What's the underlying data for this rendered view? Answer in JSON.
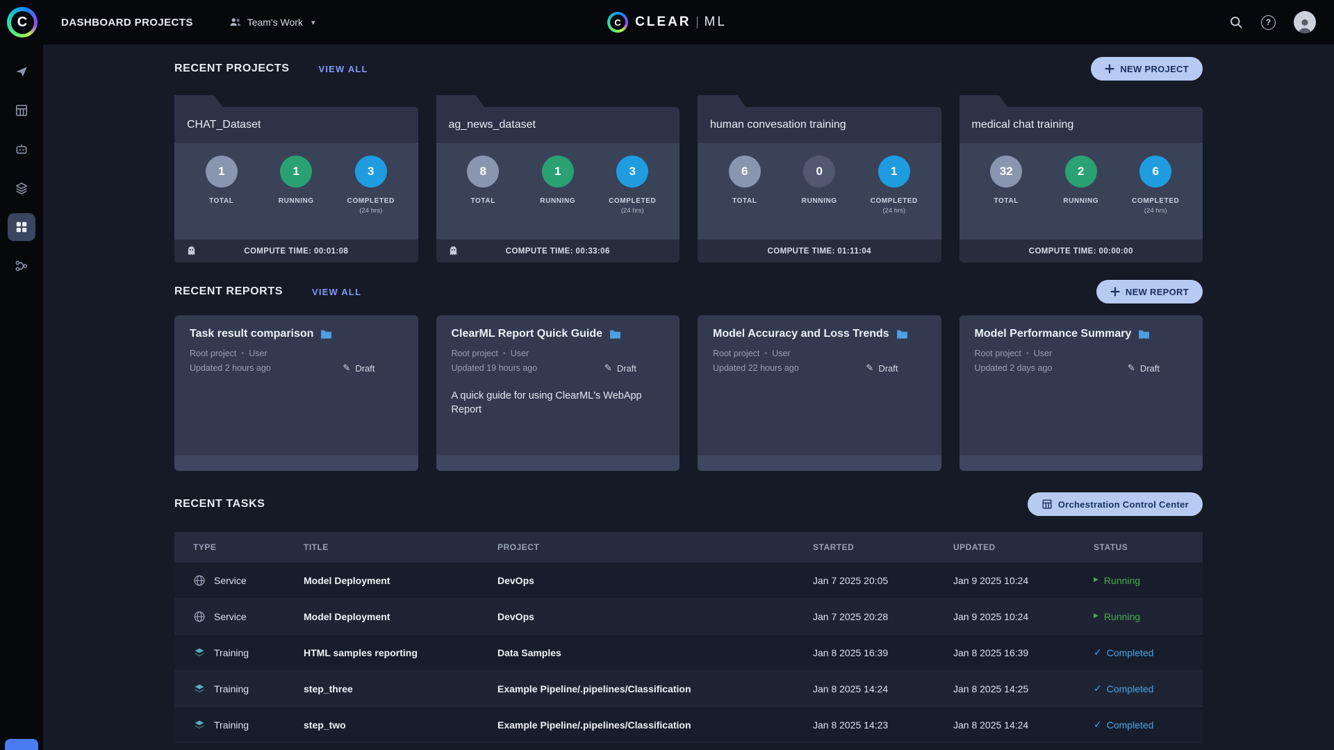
{
  "topbar": {
    "title": "DASHBOARD PROJECTS",
    "workspace": "Team's Work",
    "logo": {
      "clear": "CLEAR",
      "ml": "ML"
    }
  },
  "icons": {
    "logo_letter": "C",
    "caret": "▾",
    "question": "?",
    "dot": "•",
    "pencil": "✎",
    "play": "▶",
    "check": "✓"
  },
  "colors": {
    "accent_link": "#7f9cf7",
    "pill_bg": "#b7cbf2",
    "pill_text": "#17305e",
    "running_green": "#2aa173",
    "completed_blue": "#1f9ce0",
    "status_running": "#47ad4d",
    "status_completed": "#4aa4e8",
    "card_bg": "#3a4258",
    "page_bg": "#151a27"
  },
  "projects_section": {
    "heading": "RECENT PROJECTS",
    "view_all": "VIEW ALL",
    "new_button": "NEW PROJECT",
    "labels": {
      "total": "TOTAL",
      "running": "RUNNING",
      "completed": "COMPLETED",
      "period": "(24 hrs)"
    },
    "cards": [
      {
        "name": "CHAT_Dataset",
        "total": "1",
        "running": "1",
        "completed": "3",
        "compute_time": "COMPUTE TIME: 00:01:08",
        "ghost": true
      },
      {
        "name": "ag_news_dataset",
        "total": "8",
        "running": "1",
        "completed": "3",
        "compute_time": "COMPUTE TIME: 00:33:06",
        "ghost": true
      },
      {
        "name": "human convesation training",
        "total": "6",
        "running": "0",
        "completed": "1",
        "compute_time": "COMPUTE TIME: 01:11:04",
        "ghost": false
      },
      {
        "name": "medical chat training",
        "total": "32",
        "running": "2",
        "completed": "6",
        "compute_time": "COMPUTE TIME: 00:00:00",
        "ghost": false
      }
    ]
  },
  "reports_section": {
    "heading": "RECENT REPORTS",
    "view_all": "VIEW ALL",
    "new_button": "NEW REPORT",
    "cards": [
      {
        "title": "Task result comparison",
        "meta_project": "Root project",
        "meta_user": "User",
        "updated": "Updated 2 hours ago",
        "status": "Draft",
        "description": ""
      },
      {
        "title": "ClearML Report Quick Guide",
        "meta_project": "Root project",
        "meta_user": "User",
        "updated": "Updated 19 hours ago",
        "status": "Draft",
        "description": "A quick guide for using ClearML's WebApp Report"
      },
      {
        "title": "Model Accuracy and Loss Trends",
        "meta_project": "Root project",
        "meta_user": "User",
        "updated": "Updated 22 hours ago",
        "status": "Draft",
        "description": ""
      },
      {
        "title": "Model Performance Summary",
        "meta_project": "Root project",
        "meta_user": "User",
        "updated": "Updated 2 days ago",
        "status": "Draft",
        "description": ""
      }
    ]
  },
  "tasks_section": {
    "heading": "RECENT TASKS",
    "orchestration_button": "Orchestration Control Center",
    "columns": [
      "TYPE",
      "TITLE",
      "PROJECT",
      "STARTED",
      "UPDATED",
      "STATUS"
    ],
    "rows": [
      {
        "type": "Service",
        "title": "Model Deployment",
        "project": "DevOps",
        "started": "Jan 7 2025 20:05",
        "updated": "Jan 9 2025 10:24",
        "status": "Running"
      },
      {
        "type": "Service",
        "title": "Model Deployment",
        "project": "DevOps",
        "started": "Jan 7 2025 20:28",
        "updated": "Jan 9 2025 10:24",
        "status": "Running"
      },
      {
        "type": "Training",
        "title": "HTML samples reporting",
        "project": "Data Samples",
        "started": "Jan 8 2025 16:39",
        "updated": "Jan 8 2025 16:39",
        "status": "Completed"
      },
      {
        "type": "Training",
        "title": "step_three",
        "project": "Example Pipeline/.pipelines/Classification",
        "started": "Jan 8 2025 14:24",
        "updated": "Jan 8 2025 14:25",
        "status": "Completed"
      },
      {
        "type": "Training",
        "title": "step_two",
        "project": "Example Pipeline/.pipelines/Classification",
        "started": "Jan 8 2025 14:23",
        "updated": "Jan 8 2025 14:24",
        "status": "Completed"
      }
    ]
  }
}
